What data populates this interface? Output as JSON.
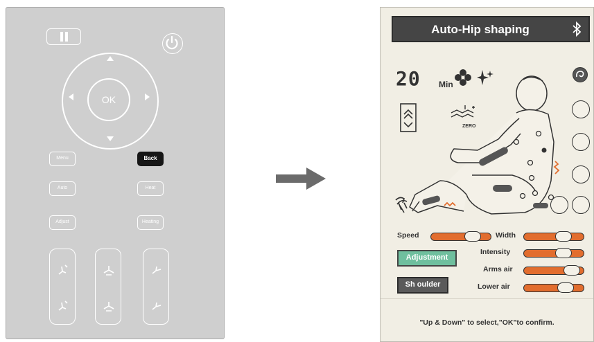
{
  "remote": {
    "ok_label": "OK",
    "buttons": {
      "menu": "Menu",
      "back": "Back",
      "auto": "Auto",
      "heat": "Heat",
      "adjust": "Adjust",
      "heating": "Heating"
    }
  },
  "panel": {
    "title": "Auto-Hip shaping",
    "timer_value": "20",
    "timer_unit": "Min",
    "zero_label": "ZERO",
    "sliders": {
      "speed": {
        "label": "Speed",
        "level": 0.78
      },
      "width": {
        "label": "Width",
        "level": 0.72
      },
      "intensity": {
        "label": "Intensity",
        "level": 0.72
      },
      "arms_air": {
        "label": "Arms air",
        "level": 0.92
      },
      "lower_air": {
        "label": "Lower air",
        "level": 0.78
      }
    },
    "adjustment_label": "Adjustment",
    "shoulder_label": "Sh oulder",
    "footer_text": "\"Up &  Down\" to select,\"OK\"to confirm."
  },
  "colors": {
    "remote_body": "#cfcfcf",
    "panel_bg": "#f1eee4",
    "title_bar": "#454545",
    "slider_track": "#e26d2e",
    "adjustment_active": "#6fbf9e",
    "arrow": "#6b6b6b"
  },
  "icons": [
    "pause-icon",
    "power-icon",
    "bluetooth-icon",
    "fan-icon",
    "sparkle-icon",
    "recline-icon",
    "zero-gravity-icon",
    "massage-chair-body-icon",
    "hand-icon"
  ]
}
